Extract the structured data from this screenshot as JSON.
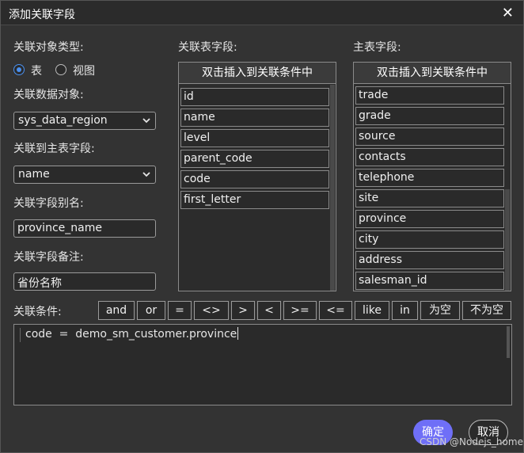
{
  "dialog": {
    "title": "添加关联字段",
    "close_glyph": "✕"
  },
  "left": {
    "obj_type_label": "关联对象类型:",
    "radio_table": "表",
    "radio_view": "视图",
    "data_obj_label": "关联数据对象:",
    "data_obj_value": "sys_data_region",
    "main_field_label": "关联到主表字段:",
    "main_field_value": "name",
    "alias_label": "关联字段别名:",
    "alias_value": "province_name",
    "remark_label": "关联字段备注:",
    "remark_value": "省份名称"
  },
  "related_fields": {
    "label": "关联表字段:",
    "header": "双击插入到关联条件中",
    "items": [
      "id",
      "name",
      "level",
      "parent_code",
      "code",
      "first_letter"
    ]
  },
  "main_fields": {
    "label": "主表字段:",
    "header": "双击插入到关联条件中",
    "items": [
      "trade",
      "grade",
      "source",
      "contacts",
      "telephone",
      "site",
      "province",
      "city",
      "address",
      "salesman_id"
    ]
  },
  "condition": {
    "label": "关联条件:",
    "operators": [
      "and",
      "or",
      "=",
      "<>",
      ">",
      "<",
      ">=",
      "<=",
      "like",
      "in",
      "为空",
      "不为空"
    ],
    "code": "code  =  demo_sm_customer.province"
  },
  "footer": {
    "ok": "确定",
    "cancel": "取消",
    "watermark": "CSDN @Nodejs_home"
  },
  "colors": {
    "primary": "#6f6ff7",
    "radio_accent": "#4a90f0"
  }
}
